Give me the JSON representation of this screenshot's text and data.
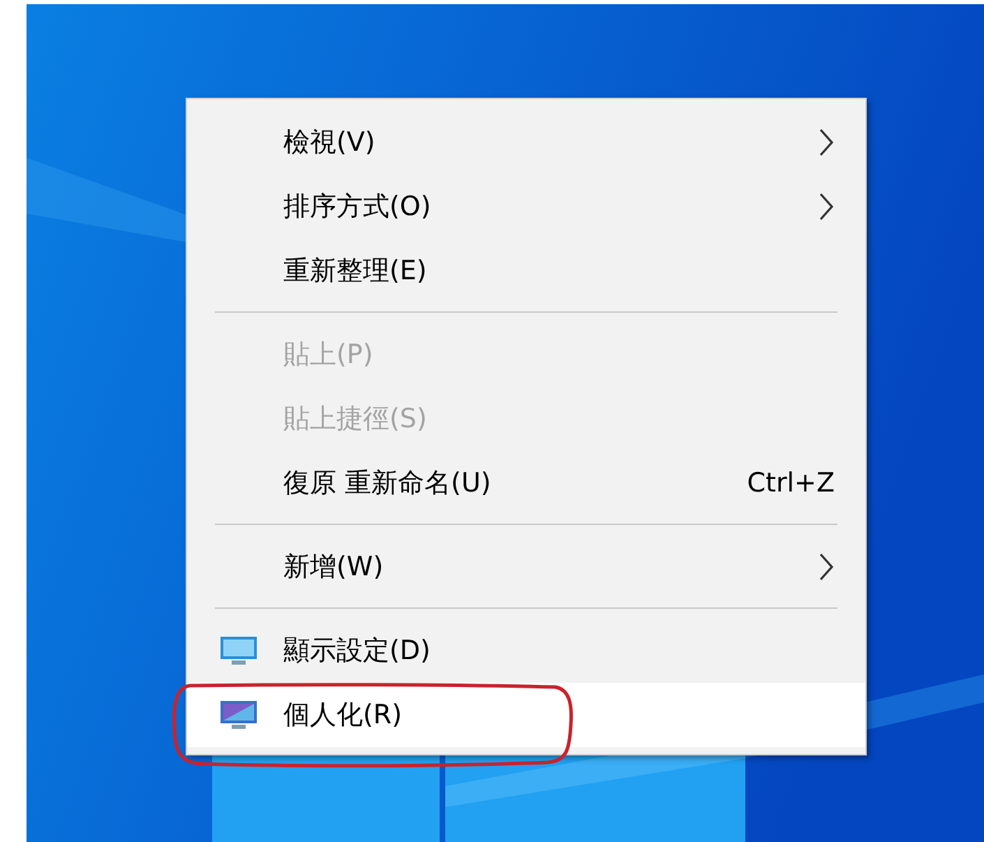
{
  "context_menu": {
    "items": [
      {
        "kind": "item",
        "label": "檢視(V)",
        "submenu": true,
        "disabled": false,
        "selected": false
      },
      {
        "kind": "item",
        "label": "排序方式(O)",
        "submenu": true,
        "disabled": false,
        "selected": false
      },
      {
        "kind": "item",
        "label": "重新整理(E)",
        "submenu": false,
        "disabled": false,
        "selected": false
      },
      {
        "kind": "separator"
      },
      {
        "kind": "item",
        "label": "貼上(P)",
        "submenu": false,
        "disabled": true,
        "selected": false
      },
      {
        "kind": "item",
        "label": "貼上捷徑(S)",
        "submenu": false,
        "disabled": true,
        "selected": false
      },
      {
        "kind": "item",
        "label": "復原 重新命名(U)",
        "shortcut": "Ctrl+Z",
        "submenu": false,
        "disabled": false,
        "selected": false
      },
      {
        "kind": "separator"
      },
      {
        "kind": "item",
        "label": "新增(W)",
        "submenu": true,
        "disabled": false,
        "selected": false
      },
      {
        "kind": "separator"
      },
      {
        "kind": "icon-item",
        "label": "顯示設定(D)",
        "submenu": false,
        "disabled": false,
        "selected": false
      },
      {
        "kind": "icon-item",
        "label": "個人化(R)",
        "submenu": false,
        "disabled": false,
        "selected": true
      }
    ]
  }
}
